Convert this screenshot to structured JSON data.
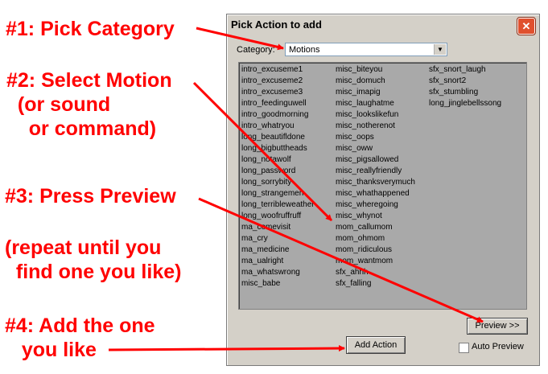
{
  "annotations": {
    "step1": "#1: Pick Category",
    "step2": "#2: Select Motion\n  (or sound\n    or command)",
    "step3": "#3: Press Preview",
    "step3_note": "(repeat until you\n  find one you like)",
    "step4": "#4: Add the one\n   you like",
    "color": "#ff0000"
  },
  "dialog": {
    "title": "Pick Action to add",
    "close_icon": "close-x-icon",
    "category_label": "Category:",
    "category_value": "Motions",
    "list_columns": [
      [
        "intro_excuseme1",
        "intro_excuseme2",
        "intro_excuseme3",
        "intro_feedinguwell",
        "intro_goodmorning",
        "intro_whatryou",
        "long_beautifldone",
        "long_bigbuttheads",
        "long_notawolf",
        "long_password",
        "long_sorrybity",
        "long_strangemen",
        "long_terribleweather",
        "long_woofruffruff",
        "ma_comevisit",
        "ma_cry",
        "ma_medicine",
        "ma_ualright",
        "ma_whatswrong",
        "misc_babe"
      ],
      [
        "misc_biteyou",
        "misc_domuch",
        "misc_imapig",
        "misc_laughatme",
        "misc_lookslikefun",
        "misc_notherenot",
        "misc_oops",
        "misc_oww",
        "misc_pigsallowed",
        "misc_reallyfriendly",
        "misc_thanksverymuch",
        "misc_whathappened",
        "misc_wheregoing",
        "misc_whynot",
        "mom_callumom",
        "mom_ohmom",
        "mom_ridiculous",
        "mom_wantmom",
        "sfx_ahhh",
        "sfx_falling"
      ],
      [
        "sfx_snort_laugh",
        "sfx_snort2",
        "sfx_stumbling",
        "long_jinglebellssong"
      ]
    ],
    "preview_label": "Preview >>",
    "add_action_label": "Add Action",
    "auto_preview_label": "Auto Preview",
    "auto_preview_checked": false
  }
}
